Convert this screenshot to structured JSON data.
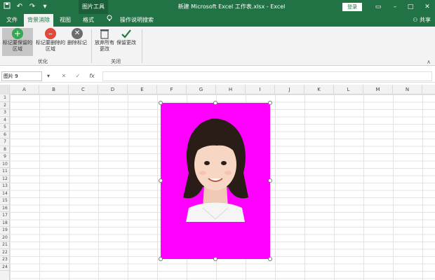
{
  "window": {
    "title": "新建 Microsoft Excel 工作表.xlsx  -  Excel",
    "context_tool": "图片工具",
    "login_label": "登录",
    "controls": [
      "▭",
      "–",
      "□",
      "✕"
    ]
  },
  "qat": {
    "icons": [
      "save-icon",
      "undo-icon",
      "redo-icon",
      "customize-icon"
    ]
  },
  "tabs": [
    {
      "label": "文件",
      "active": false
    },
    {
      "label": "背景消除",
      "active": true
    },
    {
      "label": "视图",
      "active": false
    },
    {
      "label": "格式",
      "active": false
    },
    {
      "label": "操作说明搜索",
      "active": false
    }
  ],
  "share_label": "共享",
  "ribbon": {
    "mark_keep": "标记要保留的区域",
    "mark_remove": "标记要删除的区域",
    "delete_mark": "删除标记",
    "discard_changes": "放弃所有更改",
    "keep_changes": "保留更改",
    "group_optimize": "优化",
    "group_close": "关闭"
  },
  "formula_bar": {
    "name_box": "图片 9",
    "fx_label": "fx",
    "value": ""
  },
  "columns": [
    "A",
    "B",
    "C",
    "D",
    "E",
    "F",
    "G",
    "H",
    "I",
    "J",
    "K",
    "L",
    "M",
    "N"
  ],
  "rows": [
    "1",
    "2",
    "3",
    "4",
    "5",
    "6",
    "7",
    "8",
    "9",
    "10",
    "11",
    "12",
    "13",
    "14",
    "15",
    "16",
    "17",
    "18",
    "19",
    "20",
    "21",
    "22",
    "23",
    "24"
  ],
  "picture": {
    "description_icon": "portrait-image",
    "background_color": "#ff00ff"
  },
  "colors": {
    "accent": "#217346",
    "selected_bg": "#ff00ff"
  }
}
